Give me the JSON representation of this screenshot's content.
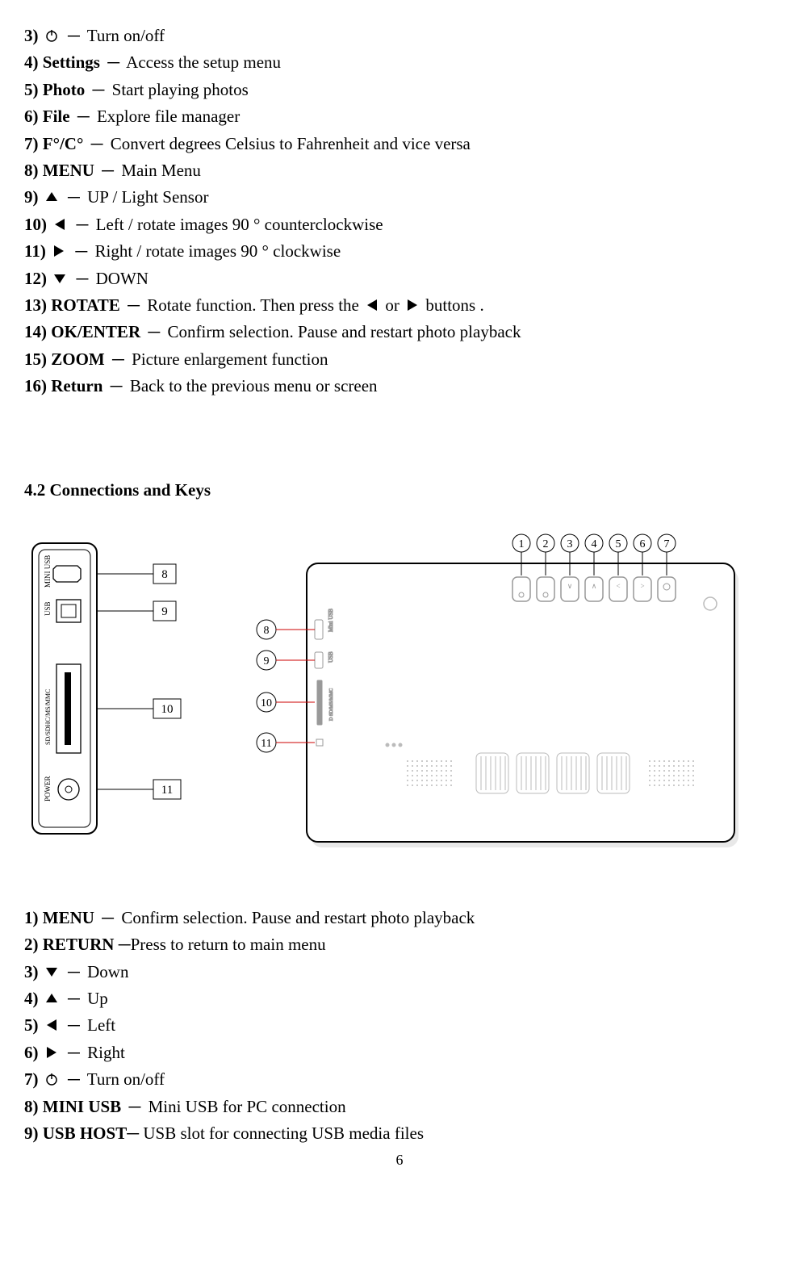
{
  "list1": {
    "i3": {
      "num": "3)",
      "label": "",
      "desc": "Turn on/off",
      "icon": "power"
    },
    "i4": {
      "num": "4)",
      "label": "Settings",
      "desc": "Access the setup menu"
    },
    "i5": {
      "num": "5)",
      "label": "Photo",
      "desc": "Start playing photos"
    },
    "i6": {
      "num": "6)",
      "label": "File",
      "desc": "Explore file manager"
    },
    "i7": {
      "num": "7)",
      "label": "F°/C°",
      "desc": "Convert degrees Celsius to Fahrenheit and vice versa"
    },
    "i8": {
      "num": "8)",
      "label": "MENU",
      "desc": "Main Menu"
    },
    "i9": {
      "num": "9)",
      "label": "",
      "desc": "UP / Light Sensor",
      "icon": "up"
    },
    "i10": {
      "num": "10)",
      "label": "",
      "desc": "Left / rotate images 90 ° counterclockwise",
      "icon": "left"
    },
    "i11": {
      "num": "11)",
      "label": "",
      "desc": "Right / rotate images 90 ° clockwise",
      "icon": "right"
    },
    "i12": {
      "num": "12)",
      "label": "",
      "desc": "DOWN",
      "icon": "down"
    },
    "i13": {
      "num": "13)",
      "label": "ROTATE",
      "desc_a": "Rotate function. Then press the",
      "desc_b": "or",
      "desc_c": "buttons ."
    },
    "i14": {
      "num": "14)",
      "label": "OK/ENTER",
      "desc": "Confirm selection. Pause and restart photo playback"
    },
    "i15": {
      "num": "15)",
      "label": "ZOOM",
      "desc": "Picture enlargement function"
    },
    "i16": {
      "num": "16)",
      "label": "Return",
      "desc": "Back to the previous menu or screen"
    }
  },
  "section_title": "4.2 Connections and Keys",
  "diagram": {
    "side_panel": {
      "mini_usb": "MINI USB",
      "usb": "USB",
      "sd": "SD/SDHC/MS/MMC",
      "power": "POWER",
      "callouts": {
        "c8": "8",
        "c9": "9",
        "c10": "10",
        "c11": "11"
      }
    },
    "back_panel": {
      "top": {
        "c1": "1",
        "c2": "2",
        "c3": "3",
        "c4": "4",
        "c5": "5",
        "c6": "6",
        "c7": "7"
      },
      "side": {
        "c8": "8",
        "c9": "9",
        "c10": "10",
        "c11": "11"
      },
      "port_labels": {
        "mini_usb": "Mini USB",
        "usb": "USB",
        "sd": "D SD/MS/MMC"
      }
    }
  },
  "list2": {
    "i1": {
      "num": "1)",
      "label": "MENU",
      "desc": "Confirm selection. Pause and restart photo playback"
    },
    "i2": {
      "num": "2)",
      "label": "RETURN",
      "desc": "Press to return to main menu",
      "nodash_space": true
    },
    "i3": {
      "num": "3)",
      "label": "",
      "desc": "Down",
      "icon": "down"
    },
    "i4": {
      "num": "4)",
      "label": "",
      "desc": "Up",
      "icon": "up"
    },
    "i5": {
      "num": "5)",
      "label": "",
      "desc": "Left",
      "icon": "left"
    },
    "i6": {
      "num": "6)",
      "label": "",
      "desc": "Right",
      "icon": "right"
    },
    "i7": {
      "num": "7)",
      "label": "",
      "desc": "Turn on/off",
      "icon": "power"
    },
    "i8": {
      "num": "8)",
      "label": "MINI USB",
      "desc": "Mini USB for PC connection"
    },
    "i9": {
      "num": "9)",
      "label": "USB HOST",
      "desc": "USB slot for connecting USB media files",
      "tight": true
    }
  },
  "page_number": "6"
}
